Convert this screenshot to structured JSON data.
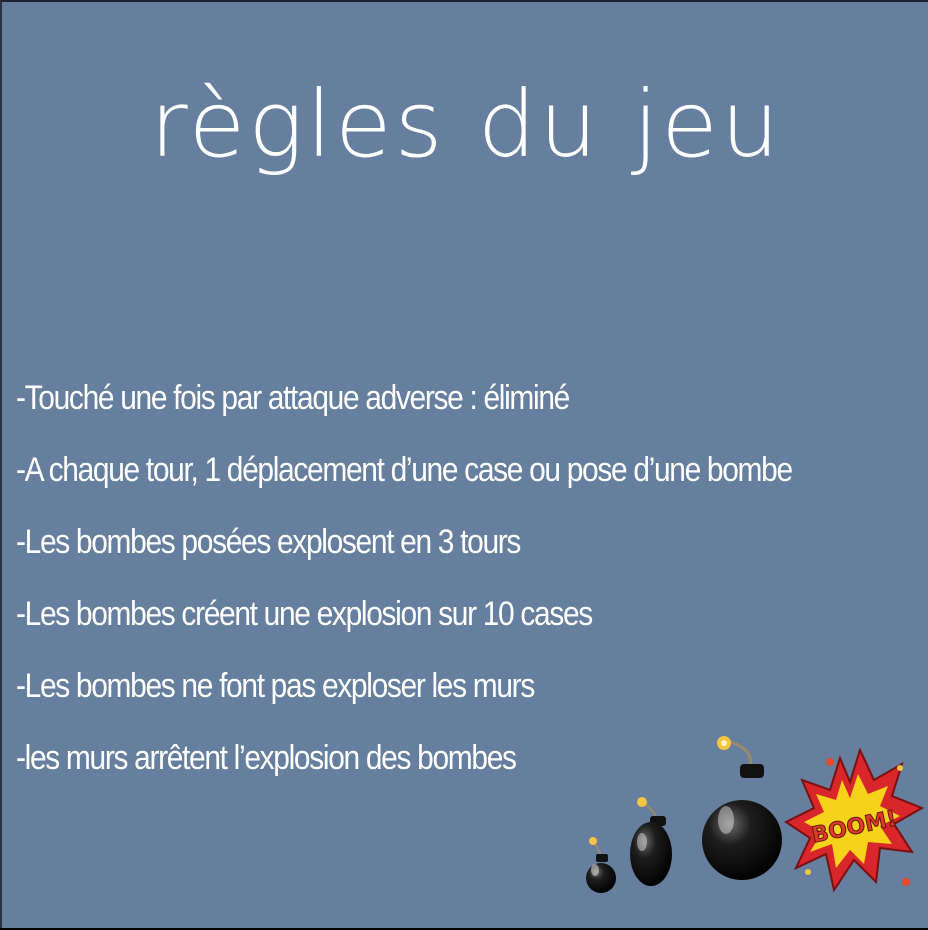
{
  "title": "règles du jeu",
  "rules": [
    "-Touché une fois par attaque adverse : éliminé",
    "-A chaque tour, 1 déplacement d’une case ou pose d’une bombe",
    "-Les bombes posées explosent en 3 tours",
    "-Les bombes créent une explosion sur 10 cases",
    "-Les bombes ne font pas exploser les murs",
    "-les murs arrêtent l’explosion des bombes"
  ],
  "illustration": {
    "icons": [
      "bomb-icon",
      "boom-explosion-icon"
    ],
    "boom_text": "BOOM!"
  },
  "colors": {
    "background": "#667f9f",
    "text": "#ffffff",
    "boom_red": "#d8262a",
    "boom_yellow": "#f7d21a"
  }
}
